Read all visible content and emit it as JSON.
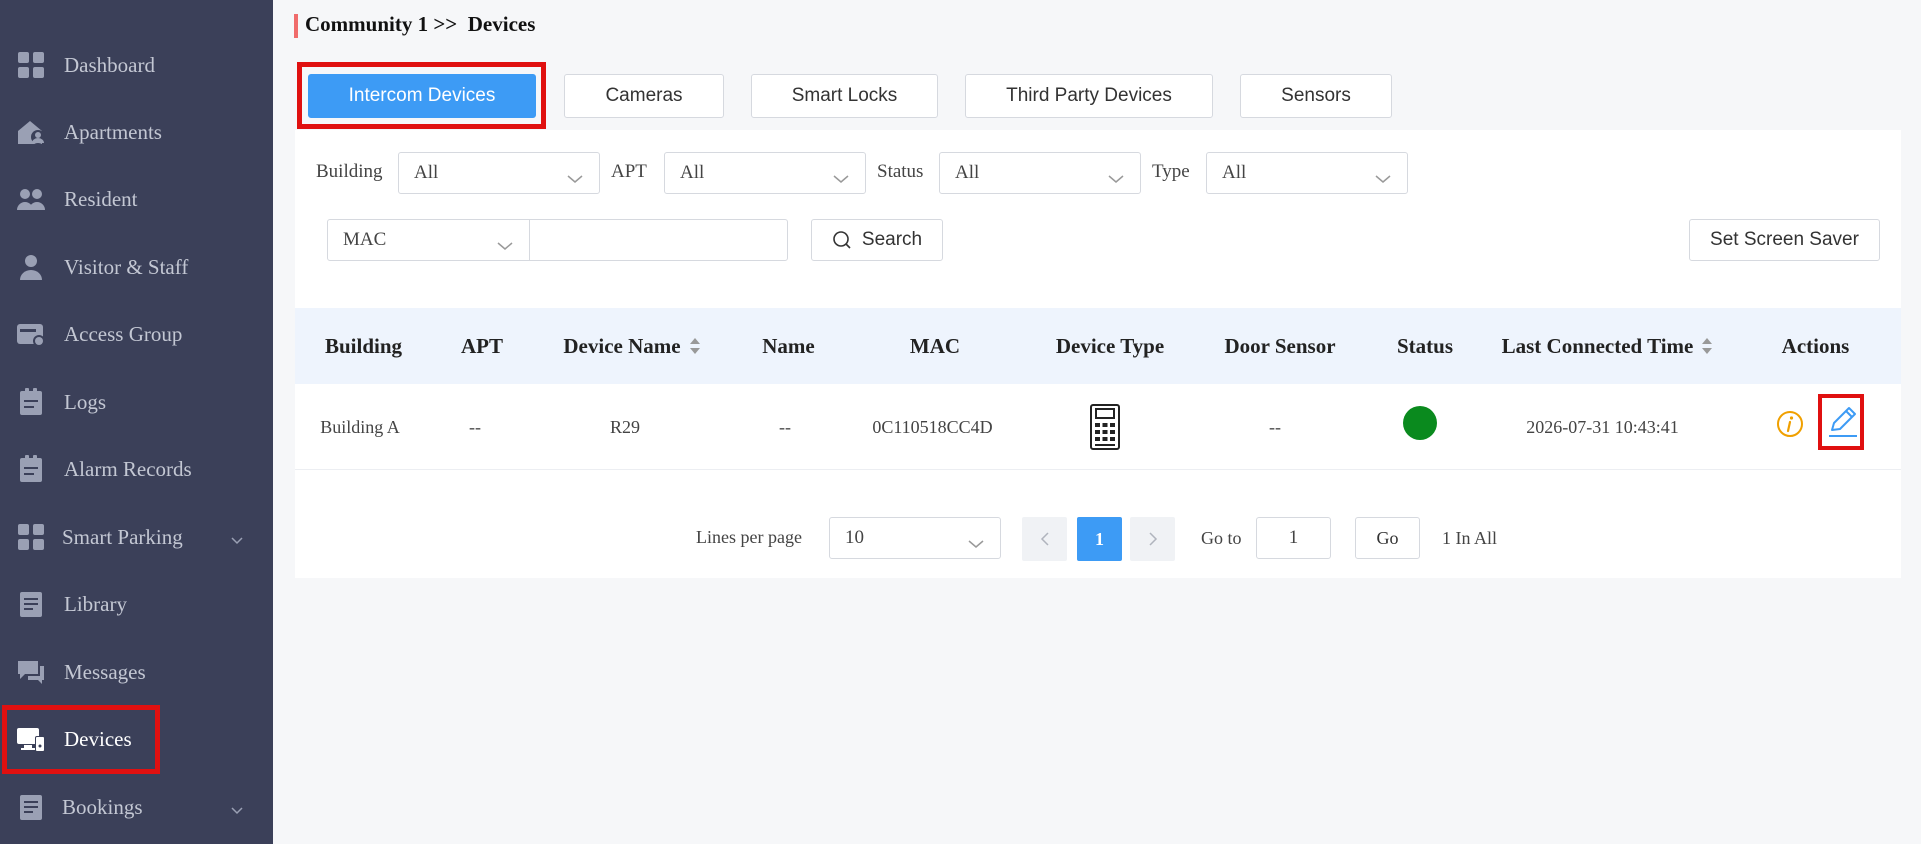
{
  "sidebar": {
    "items": [
      {
        "label": "Dashboard",
        "icon": "dashboard-grid-icon"
      },
      {
        "label": "Apartments",
        "icon": "apartment-house-icon"
      },
      {
        "label": "Resident",
        "icon": "residents-group-icon"
      },
      {
        "label": "Visitor & Staff",
        "icon": "visitor-person-icon"
      },
      {
        "label": "Access Group",
        "icon": "access-card-icon"
      },
      {
        "label": "Logs",
        "icon": "clipboard-icon"
      },
      {
        "label": "Alarm Records",
        "icon": "clipboard-icon"
      },
      {
        "label": "Smart Parking",
        "icon": "parking-grid-icon"
      },
      {
        "label": "Library",
        "icon": "document-icon"
      },
      {
        "label": "Messages",
        "icon": "chat-bubbles-icon"
      },
      {
        "label": "Devices",
        "icon": "devices-monitor-icon"
      },
      {
        "label": "Bookings",
        "icon": "document-icon"
      }
    ],
    "active": "Devices"
  },
  "breadcrumb": "Community 1 >>  Devices",
  "tabs": [
    "Intercom Devices",
    "Cameras",
    "Smart Locks",
    "Third Party Devices",
    "Sensors"
  ],
  "selected_tab": "Intercom Devices",
  "filters": {
    "building_label": "Building",
    "building_value": "All",
    "apt_label": "APT",
    "apt_value": "All",
    "status_label": "Status",
    "status_value": "All",
    "type_label": "Type",
    "type_value": "All",
    "search_field": "MAC",
    "search_value": "",
    "search_button": "Search",
    "screen_saver_button": "Set Screen Saver"
  },
  "table": {
    "columns": [
      "Building",
      "APT",
      "Device Name",
      "Name",
      "MAC",
      "Device Type",
      "Door Sensor",
      "Status",
      "Last Connected Time",
      "Actions"
    ],
    "rows": [
      {
        "building": "Building A",
        "apt": "--",
        "device_name": "R29",
        "name": "--",
        "mac": "0C110518CC4D",
        "device_type_icon": "intercom-keypad-icon",
        "door_sensor": "--",
        "status_color": "#0a8a1e",
        "last_connected": "2026-07-31 10:43:41"
      }
    ]
  },
  "pagination": {
    "lines_label": "Lines per page",
    "lines_value": "10",
    "current_page": "1",
    "goto_label": "Go to",
    "goto_value": "1",
    "go_button": "Go",
    "total": "1 In All"
  },
  "colors": {
    "sidebar_bg": "#3b4059",
    "accent": "#3d9bf5",
    "highlight": "#e01010",
    "info_icon": "#f0a000",
    "edit_icon": "#3d9bf5"
  }
}
